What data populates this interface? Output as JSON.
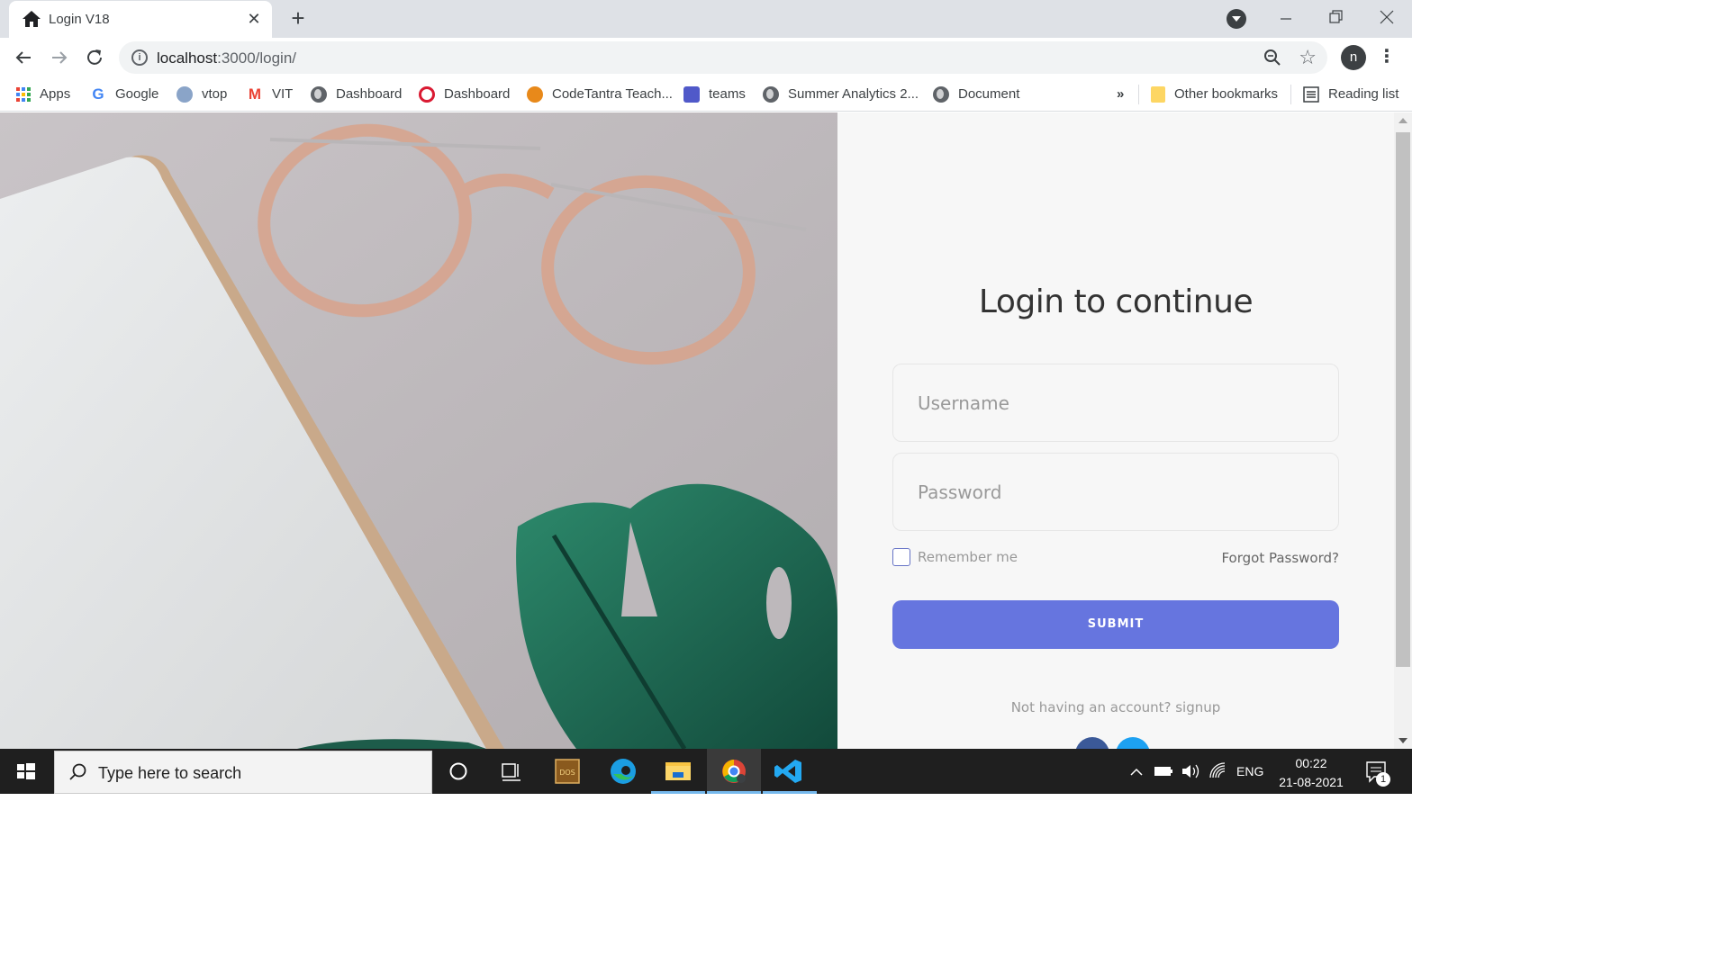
{
  "browser": {
    "tab_title": "Login V18",
    "url_host": "localhost",
    "url_rest": ":3000/login/",
    "profile_initial": "n"
  },
  "bookmarks": [
    {
      "label": "Apps",
      "icon": "apps-grid-icon"
    },
    {
      "label": "Google",
      "icon": "google-icon"
    },
    {
      "label": "vtop",
      "icon": "vtop-icon"
    },
    {
      "label": "VIT",
      "icon": "gmail-icon"
    },
    {
      "label": "Dashboard",
      "icon": "globe-icon"
    },
    {
      "label": "Dashboard",
      "icon": "openstack-icon"
    },
    {
      "label": "CodeTantra Teach...",
      "icon": "codetantra-icon"
    },
    {
      "label": "teams",
      "icon": "teams-icon"
    },
    {
      "label": "Summer Analytics 2...",
      "icon": "globe-icon"
    },
    {
      "label": "Document",
      "icon": "globe-icon"
    }
  ],
  "bookmarks_overflow": "»",
  "other_bookmarks": "Other bookmarks",
  "reading_list": "Reading list",
  "login": {
    "heading": "Login to continue",
    "username_placeholder": "Username",
    "password_placeholder": "Password",
    "remember_label": "Remember me",
    "forgot_label": "Forgot Password?",
    "submit_label": "SUBMIT",
    "signup_text": "Not having an account? signup"
  },
  "taskbar": {
    "search_placeholder": "Type here to search",
    "language": "ENG",
    "time": "00:22",
    "date": "21-08-2021",
    "notification_count": "1"
  },
  "colors": {
    "accent": "#6675df",
    "leaf": "#1f6b57",
    "taskbar": "#1f1f1f"
  }
}
